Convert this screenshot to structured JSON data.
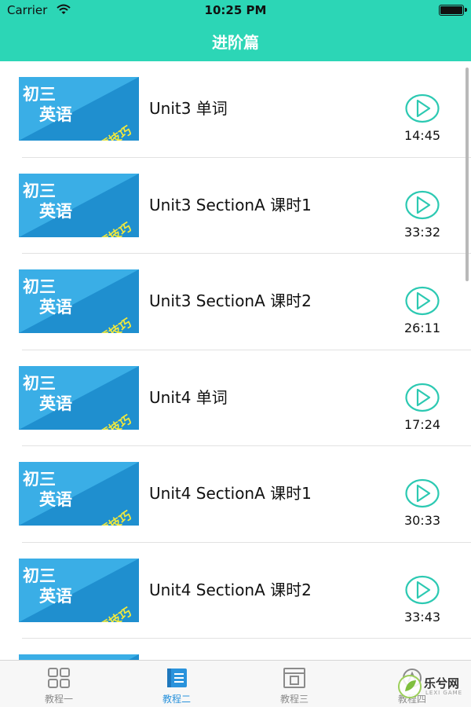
{
  "status_bar": {
    "carrier": "Carrier",
    "time": "10:25 PM"
  },
  "nav": {
    "title": "进阶篇"
  },
  "thumbnail": {
    "line1": "初三",
    "line2": "英语",
    "tag": "解题技巧"
  },
  "lessons": [
    {
      "title": "Unit3 单词",
      "duration": "14:45"
    },
    {
      "title": "Unit3 SectionA 课时1",
      "duration": "33:32"
    },
    {
      "title": "Unit3 SectionA 课时2",
      "duration": "26:11"
    },
    {
      "title": "Unit4 单词",
      "duration": "17:24"
    },
    {
      "title": "Unit4 SectionA 课时1",
      "duration": "30:33"
    },
    {
      "title": "Unit4 SectionA 课时2",
      "duration": "33:43"
    }
  ],
  "tabs": [
    {
      "label": "教程一",
      "icon": "grid-icon"
    },
    {
      "label": "教程二",
      "icon": "book-icon",
      "active": true
    },
    {
      "label": "教程三",
      "icon": "window-icon"
    },
    {
      "label": "教程四",
      "icon": "circle-icon"
    }
  ],
  "watermark": {
    "text": "乐兮网",
    "sub": "LEXI GAME"
  },
  "colors": {
    "header": "#2cd6b6",
    "accent": "#2cc9b2",
    "active_tab": "#2a93dc"
  }
}
